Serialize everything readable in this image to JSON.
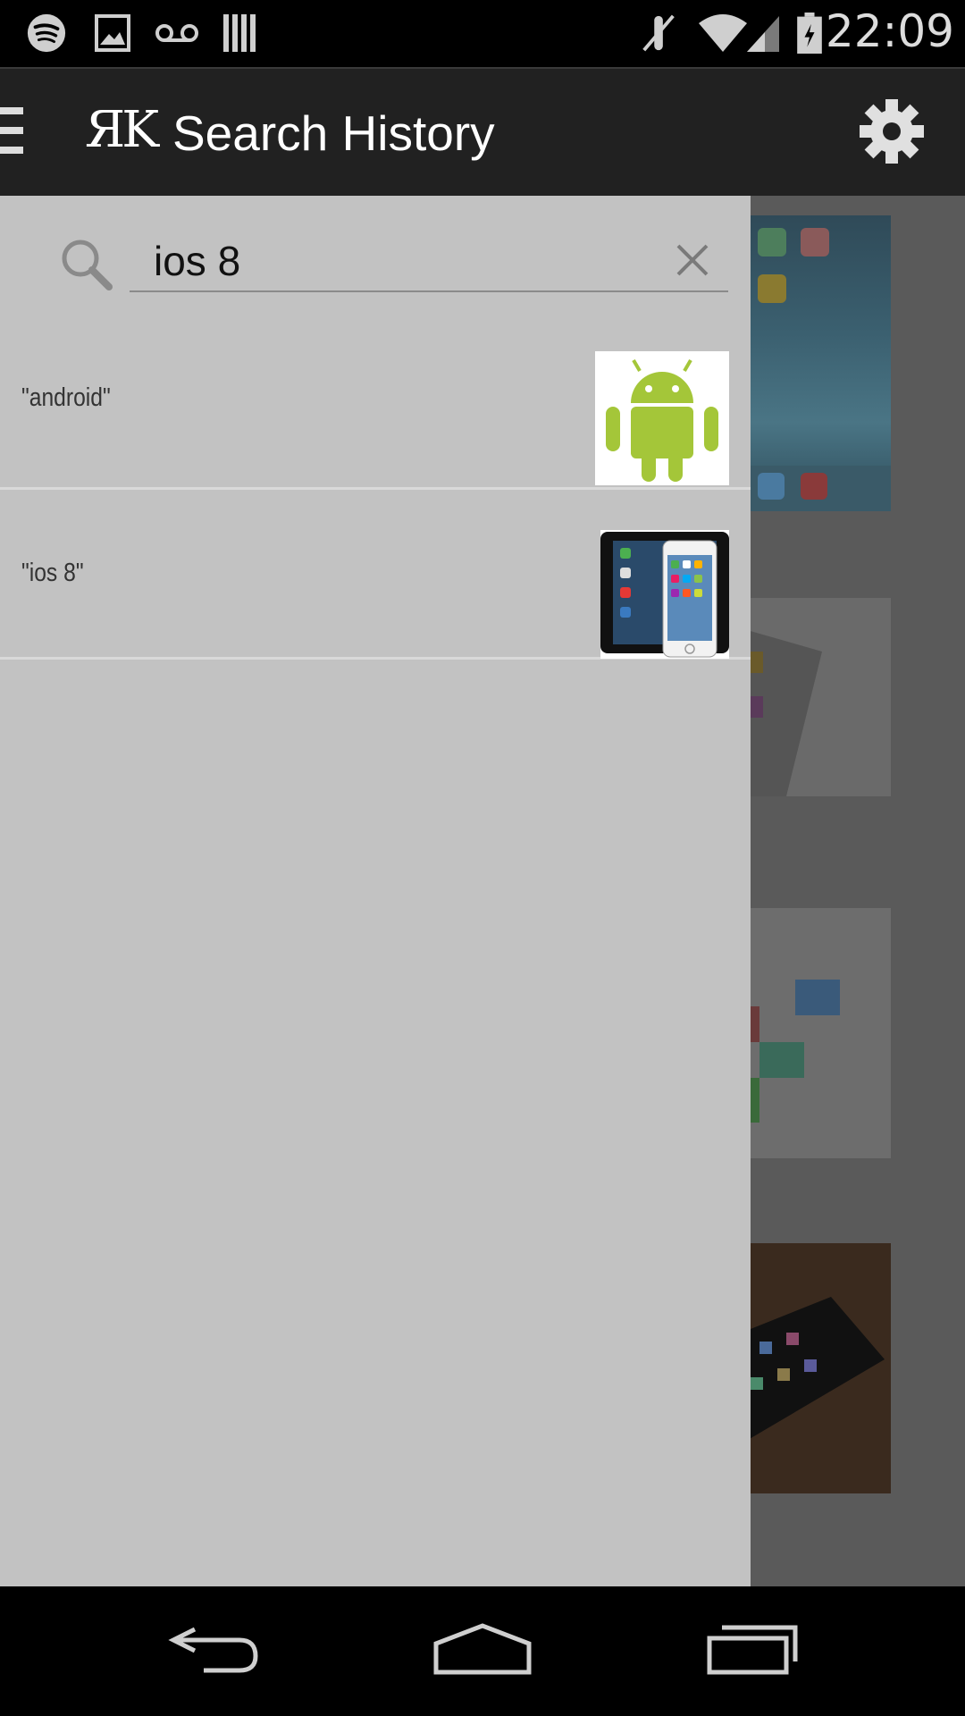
{
  "status_bar": {
    "time": "22:09",
    "left_icons": [
      "spotify-icon",
      "image-icon",
      "voicemail-icon",
      "barcode-icon"
    ],
    "right_icons": [
      "mute-icon",
      "wifi-icon",
      "signal-icon",
      "battery-charging-icon"
    ]
  },
  "action_bar": {
    "logo": "ЯK",
    "title": "Search History",
    "menu_icon": "hamburger-icon",
    "settings_icon": "gear-icon"
  },
  "drawer": {
    "search": {
      "value": "ios 8",
      "search_icon": "search-icon",
      "clear_icon": "close-icon"
    },
    "history": [
      {
        "label": "\"android\"",
        "thumbnail": "android-robot"
      },
      {
        "label": "\"ios 8\"",
        "thumbnail": "ipad-iphone"
      }
    ]
  },
  "nav_bar": {
    "buttons": [
      "back-icon",
      "home-icon",
      "recents-icon"
    ]
  },
  "colors": {
    "drawer_bg": "#c2c2c2",
    "action_bar_bg": "#212121",
    "android_green": "#a4c639"
  }
}
